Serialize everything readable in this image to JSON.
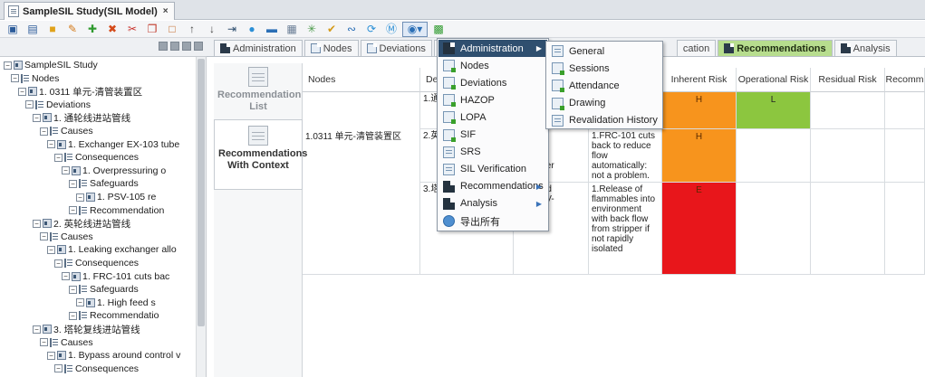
{
  "window": {
    "tab_title": "SampleSIL Study(SIL Model)",
    "close": "×"
  },
  "toolbar": {
    "buttons": [
      "save-icon",
      "save-as-icon",
      "folder-icon",
      "edit-icon",
      "add-icon",
      "delete-icon",
      "cut-icon",
      "copy-icon",
      "paste-icon",
      "up-icon",
      "down-icon",
      "import-icon",
      "chat-icon",
      "table-icon",
      "grid-icon",
      "star-icon",
      "tag-icon",
      "link-icon",
      "refresh-icon",
      "s-icon",
      "report-icon",
      "export-icon"
    ]
  },
  "tree": {
    "nodes": [
      {
        "label": "SampleSIL Study",
        "level": 0,
        "icon": "item"
      },
      {
        "label": "Nodes",
        "level": 1,
        "icon": "list"
      },
      {
        "label": "1. 0311 单元-清管装置区",
        "level": 2,
        "icon": "item"
      },
      {
        "label": "Deviations",
        "level": 3,
        "icon": "list"
      },
      {
        "label": "1. 通轮线进站管线",
        "level": 4,
        "icon": "item"
      },
      {
        "label": "Causes",
        "level": 5,
        "icon": "list"
      },
      {
        "label": "1. Exchanger EX-103 tube",
        "level": 6,
        "icon": "item"
      },
      {
        "label": "Consequences",
        "level": 7,
        "icon": "list"
      },
      {
        "label": "1. Overpressuring o",
        "level": 8,
        "icon": "item"
      },
      {
        "label": "Safeguards",
        "level": 9,
        "icon": "list"
      },
      {
        "label": "1. PSV-105 re",
        "level": 10,
        "icon": "item"
      },
      {
        "label": "Recommendation",
        "level": 9,
        "icon": "list"
      },
      {
        "label": "2. 英轮线进站管线",
        "level": 4,
        "icon": "item"
      },
      {
        "label": "Causes",
        "level": 5,
        "icon": "list"
      },
      {
        "label": "1. Leaking exchanger allo",
        "level": 6,
        "icon": "item"
      },
      {
        "label": "Consequences",
        "level": 7,
        "icon": "list"
      },
      {
        "label": "1. FRC-101 cuts bac",
        "level": 8,
        "icon": "item"
      },
      {
        "label": "Safeguards",
        "level": 9,
        "icon": "list"
      },
      {
        "label": "1. High feed s",
        "level": 10,
        "icon": "item"
      },
      {
        "label": "Recommendatio",
        "level": 9,
        "icon": "list"
      },
      {
        "label": "3. 塔轮复线进站管线",
        "level": 4,
        "icon": "item"
      },
      {
        "label": "Causes",
        "level": 5,
        "icon": "list"
      },
      {
        "label": "1. Bypass around control v",
        "level": 6,
        "icon": "item"
      },
      {
        "label": "Consequences",
        "level": 7,
        "icon": "list"
      }
    ]
  },
  "report_list": {
    "items": [
      {
        "label": "Recommendation List",
        "selected": false
      },
      {
        "label": "Recommendations With Context",
        "selected": true
      }
    ]
  },
  "main_tabs": [
    {
      "label": "Administration",
      "active": false
    },
    {
      "label": "Nodes",
      "active": false
    },
    {
      "label": "Deviations",
      "active": false
    },
    {
      "label": "",
      "active": false
    },
    {
      "label": "cation",
      "active": false
    },
    {
      "label": "Recommendations",
      "active": true
    },
    {
      "label": "Analysis",
      "active": false
    }
  ],
  "grid": {
    "headers": [
      "Nodes",
      "De",
      "",
      "",
      "Inherent Risk",
      "Operational Risk",
      "Residual Risk",
      "Recomm"
    ],
    "node_cell": "1.0311 单元-清管装置区",
    "rows": [
      {
        "deviation": "1.通",
        "cause": "",
        "consequence": "",
        "inherent": "H",
        "inherent_color": "#f7941d",
        "operational": "L",
        "operational_color": "#8cc63f"
      },
      {
        "deviation": "2.英",
        "cause": "g\nger\ng hot\ns to enter\ned.",
        "consequence": "1.FRC-101 cuts back to reduce flow automatically: not a problem.",
        "inherent": "H",
        "inherent_color": "#f7941d",
        "operational": "",
        "operational_color": ""
      },
      {
        "deviation": "3.塔",
        "cause": "s around\nvalve FV-\nened",
        "consequence": "1.Release of flammables into environment with back flow from stripper if not rapidly isolated",
        "inherent": "E",
        "inherent_color": "#e8161b",
        "operational": "",
        "operational_color": ""
      }
    ]
  },
  "menu": {
    "items": [
      {
        "label": "Administration",
        "icon": "dark",
        "submenu": true,
        "highlighted": true
      },
      {
        "label": "Nodes",
        "icon": "green",
        "submenu": false,
        "highlighted": false
      },
      {
        "label": "Deviations",
        "icon": "green",
        "submenu": false,
        "highlighted": false
      },
      {
        "label": "HAZOP",
        "icon": "green",
        "submenu": false,
        "highlighted": false
      },
      {
        "label": "LOPA",
        "icon": "green",
        "submenu": false,
        "highlighted": false
      },
      {
        "label": "SIF",
        "icon": "green",
        "submenu": false,
        "highlighted": false
      },
      {
        "label": "SRS",
        "icon": "plain",
        "submenu": false,
        "highlighted": false
      },
      {
        "label": "SIL Verification",
        "icon": "plain",
        "submenu": false,
        "highlighted": false
      },
      {
        "label": "Recommendations",
        "icon": "dark",
        "submenu": true,
        "highlighted": false
      },
      {
        "label": "Analysis",
        "icon": "dark",
        "submenu": true,
        "highlighted": false
      },
      {
        "label": "导出所有",
        "icon": "globe",
        "submenu": false,
        "highlighted": false
      }
    ]
  },
  "submenu": {
    "items": [
      {
        "label": "General",
        "icon": "plain"
      },
      {
        "label": "Sessions",
        "icon": "green"
      },
      {
        "label": "Attendance",
        "icon": "green"
      },
      {
        "label": "Drawing",
        "icon": "green"
      },
      {
        "label": "Revalidation History",
        "icon": "plain"
      }
    ]
  },
  "colors": {
    "active_tab": "#b7dd8e",
    "menu_highlight": "#2f4f6f",
    "risk_high": "#f7941d",
    "risk_extreme": "#e8161b",
    "risk_low": "#8cc63f"
  }
}
